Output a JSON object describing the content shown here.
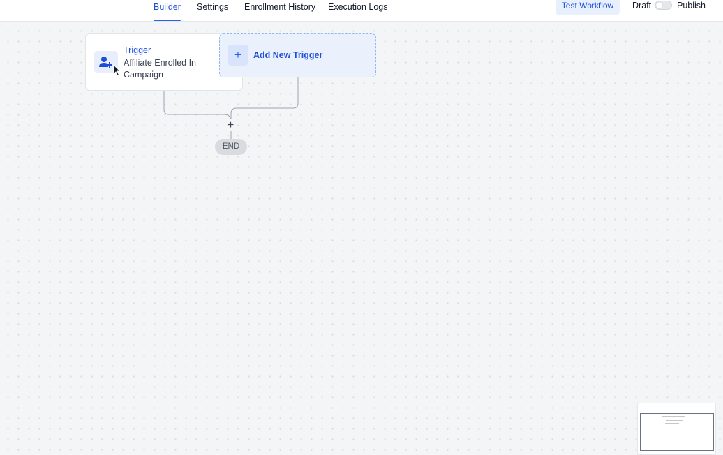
{
  "tabs": [
    {
      "label": "Builder",
      "active": true
    },
    {
      "label": "Settings",
      "active": false
    },
    {
      "label": "Enrollment History",
      "active": false
    },
    {
      "label": "Execution Logs",
      "active": false
    }
  ],
  "header": {
    "test_button": "Test Workflow",
    "draft_label": "Draft",
    "publish_label": "Publish",
    "publish_toggle_on": false
  },
  "workflow": {
    "trigger": {
      "title": "Trigger",
      "subtitle": "Affiliate Enrolled In Campaign",
      "icon": "user-plus-icon"
    },
    "add_trigger": {
      "label": "Add New Trigger",
      "icon": "plus-icon"
    },
    "add_step_icon": "plus-icon",
    "end_label": "END"
  },
  "colors": {
    "accent": "#2563eb",
    "accent_text": "#1d4ed8",
    "accent_bg": "#eaf1fd",
    "canvas_bg": "#f4f5f7"
  }
}
